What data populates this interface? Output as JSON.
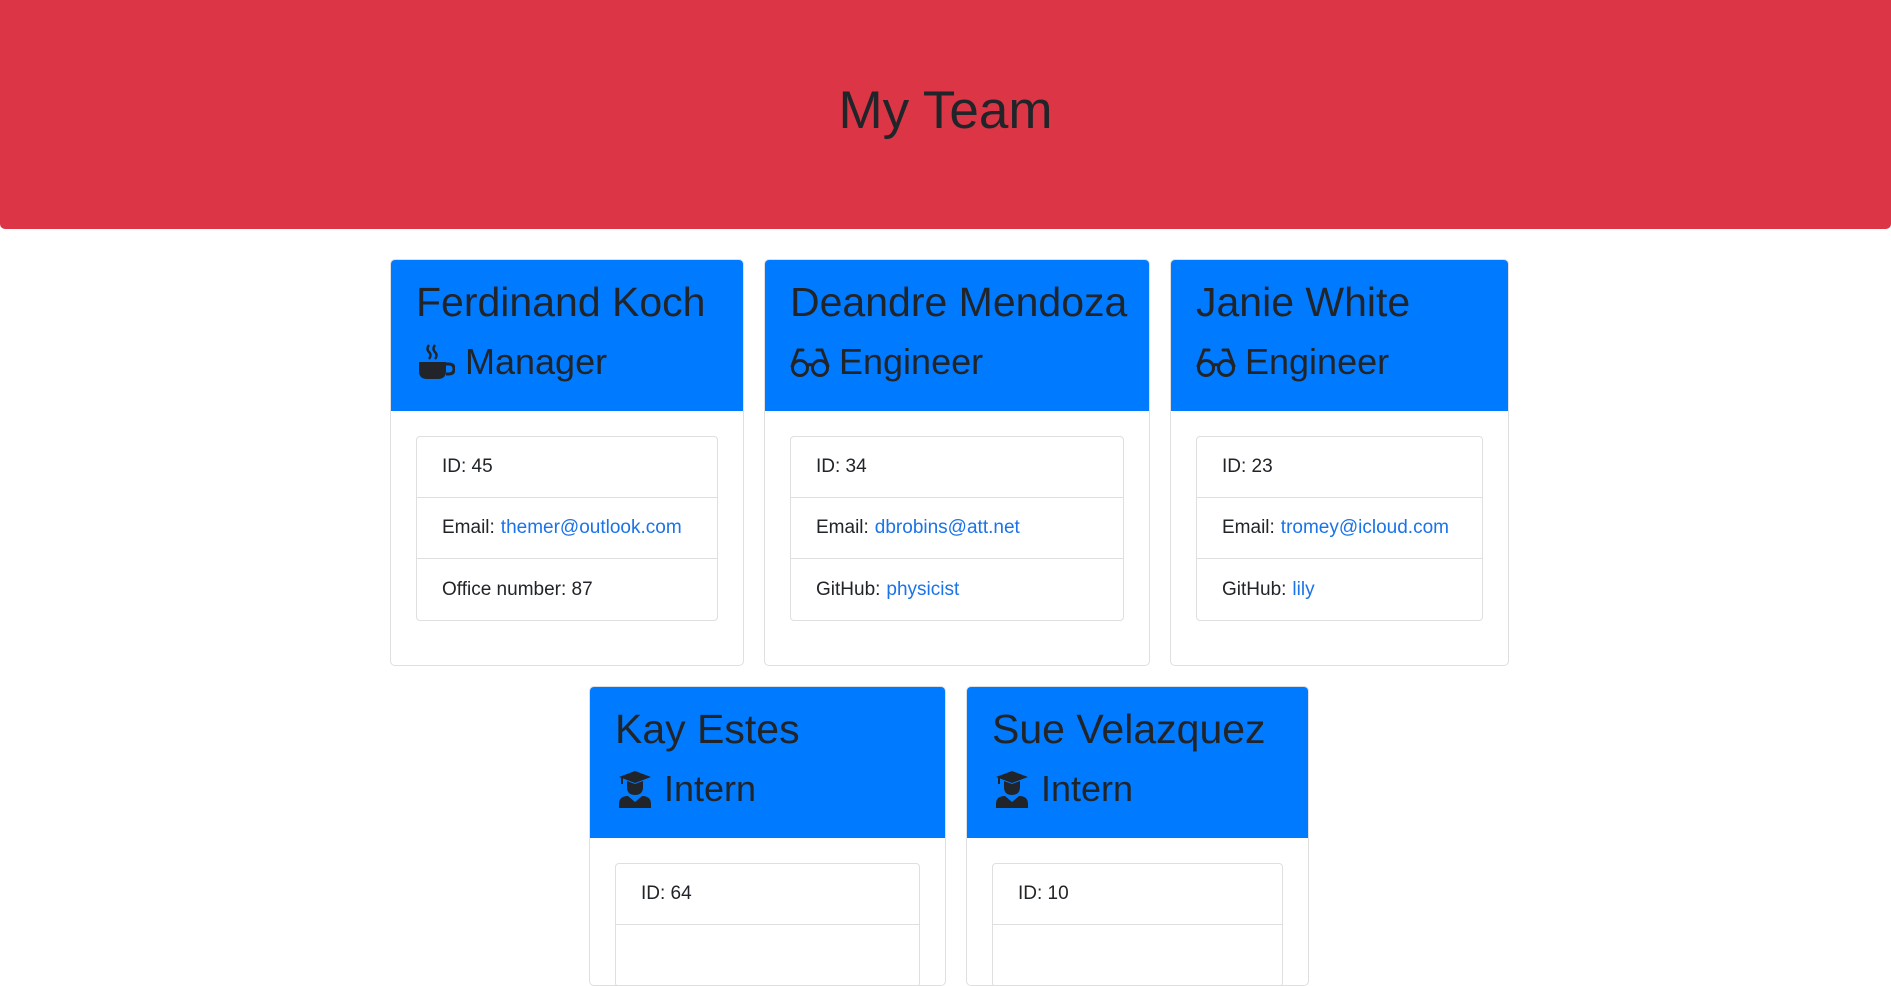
{
  "header": {
    "title": "My Team"
  },
  "colors": {
    "header_bg": "#dc3545",
    "card_header_bg": "#007bff",
    "link": "#1a73e8"
  },
  "cards": [
    {
      "name": "Ferdinand Koch",
      "role": "Manager",
      "role_icon": "mug-hot-icon",
      "id_label": "ID: 45",
      "email_label": "Email:",
      "email": "themer@outlook.com",
      "extra_label": "Office number: 87",
      "extra_value": ""
    },
    {
      "name": "Deandre Mendoza",
      "role": "Engineer",
      "role_icon": "glasses-icon",
      "id_label": "ID: 34",
      "email_label": "Email:",
      "email": "dbrobins@att.net",
      "extra_label": "GitHub:",
      "extra_value": "physicist"
    },
    {
      "name": "Janie White",
      "role": "Engineer",
      "role_icon": "glasses-icon",
      "id_label": "ID: 23",
      "email_label": "Email:",
      "email": "tromey@icloud.com",
      "extra_label": "GitHub:",
      "extra_value": "lily"
    },
    {
      "name": "Kay Estes",
      "role": "Intern",
      "role_icon": "graduate-icon",
      "id_label": "ID: 64"
    },
    {
      "name": "Sue Velazquez",
      "role": "Intern",
      "role_icon": "graduate-icon",
      "id_label": "ID: 10"
    }
  ]
}
